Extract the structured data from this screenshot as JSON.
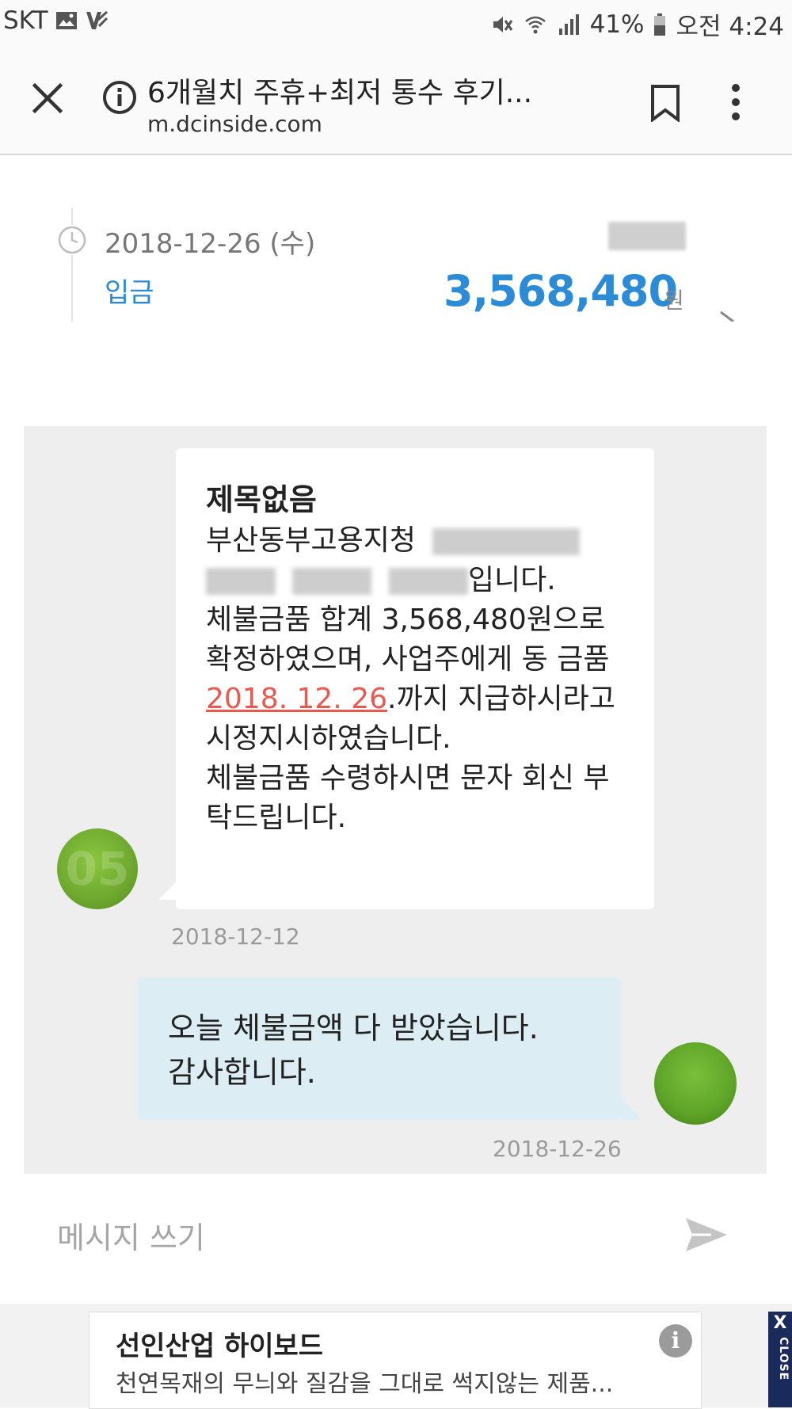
{
  "status_bar": {
    "carrier": "SKT",
    "battery": "41%",
    "time": "오전 4:24",
    "icons": [
      "image-icon",
      "v3-app-icon",
      "mute-icon",
      "wifi-icon",
      "signal-icon",
      "battery-icon"
    ]
  },
  "browser": {
    "page_title": "6개월치 주휴+최저 통수 후기...",
    "url": "m.dcinside.com",
    "icons": [
      "close-icon",
      "info-icon",
      "bookmark-icon",
      "more-vert-icon"
    ]
  },
  "transaction": {
    "date": "2018-12-26 (수)",
    "type": "입금",
    "amount": "3,568,480",
    "currency": "원"
  },
  "messages": {
    "incoming": {
      "subject": "제목없음",
      "line1": "부산동부고용지청",
      "line2_end": "입니다.",
      "body_before_date": "체불금품 합계 3,568,480원으로 확정하였으며, 사업주에게 동 금품 ",
      "due_date": "2018. 12. 26",
      "body_after_date": ".까지 지급하시라고 시정지시하였습니다.",
      "body_last": "체불금품 수령하시면 문자 회신 부탁드립니다.",
      "date": "2018-12-12"
    },
    "outgoing": {
      "line1": "오늘 체불금액 다 받았습니다.",
      "line2": "감사합니다.",
      "date": "2018-12-26"
    }
  },
  "composer": {
    "placeholder": "메시지 쓰기"
  },
  "ad": {
    "title": "선인산업 하이보드",
    "subtitle": "천연목재의 무늬와 질감을 그대로 썩지않는 제품...",
    "info": "i",
    "close_x": "X",
    "close_label": "CLOSE"
  },
  "colors": {
    "accent_blue": "#2c8bd6",
    "link_red": "#e85a4f",
    "outgoing_bubble": "#dcedf4",
    "chat_bg": "#eeeeee"
  }
}
